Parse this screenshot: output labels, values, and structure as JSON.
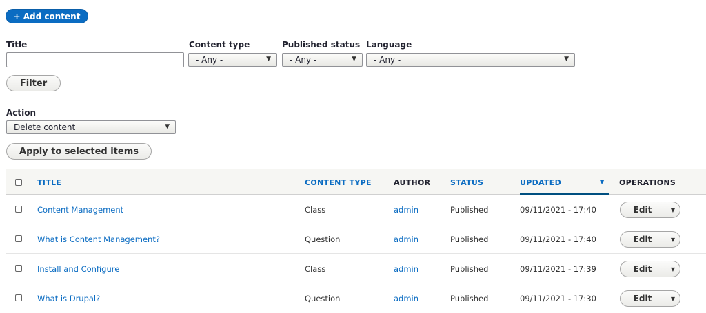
{
  "header": {
    "add_button": "+ Add content"
  },
  "filters": {
    "title_label": "Title",
    "title_value": "",
    "content_type_label": "Content type",
    "content_type_value": "- Any -",
    "published_label": "Published status",
    "published_value": "- Any -",
    "language_label": "Language",
    "language_value": "- Any -",
    "filter_button": "Filter"
  },
  "bulk": {
    "action_label": "Action",
    "action_value": "Delete content",
    "apply_button": "Apply to selected items"
  },
  "table": {
    "headers": {
      "title": "TITLE",
      "content_type": "CONTENT TYPE",
      "author": "AUTHOR",
      "status": "STATUS",
      "updated": "UPDATED",
      "operations": "OPERATIONS"
    },
    "rows": [
      {
        "title": "Content Management",
        "type": "Class",
        "author": "admin",
        "status": "Published",
        "updated": "09/11/2021 - 17:40",
        "op": "Edit"
      },
      {
        "title": "What is Content Management?",
        "type": "Question",
        "author": "admin",
        "status": "Published",
        "updated": "09/11/2021 - 17:40",
        "op": "Edit"
      },
      {
        "title": "Install and Configure",
        "type": "Class",
        "author": "admin",
        "status": "Published",
        "updated": "09/11/2021 - 17:39",
        "op": "Edit"
      },
      {
        "title": "What is Drupal?",
        "type": "Question",
        "author": "admin",
        "status": "Published",
        "updated": "09/11/2021 - 17:30",
        "op": "Edit"
      }
    ]
  },
  "colors": {
    "link": "#0b6cc2",
    "primary_button": "#0b6cc2",
    "active_sort": "#004f80"
  },
  "icons": {
    "select_caret": "caret-down-icon",
    "sort": "sort-desc-icon",
    "operations_dropdown": "chevron-down-icon"
  }
}
